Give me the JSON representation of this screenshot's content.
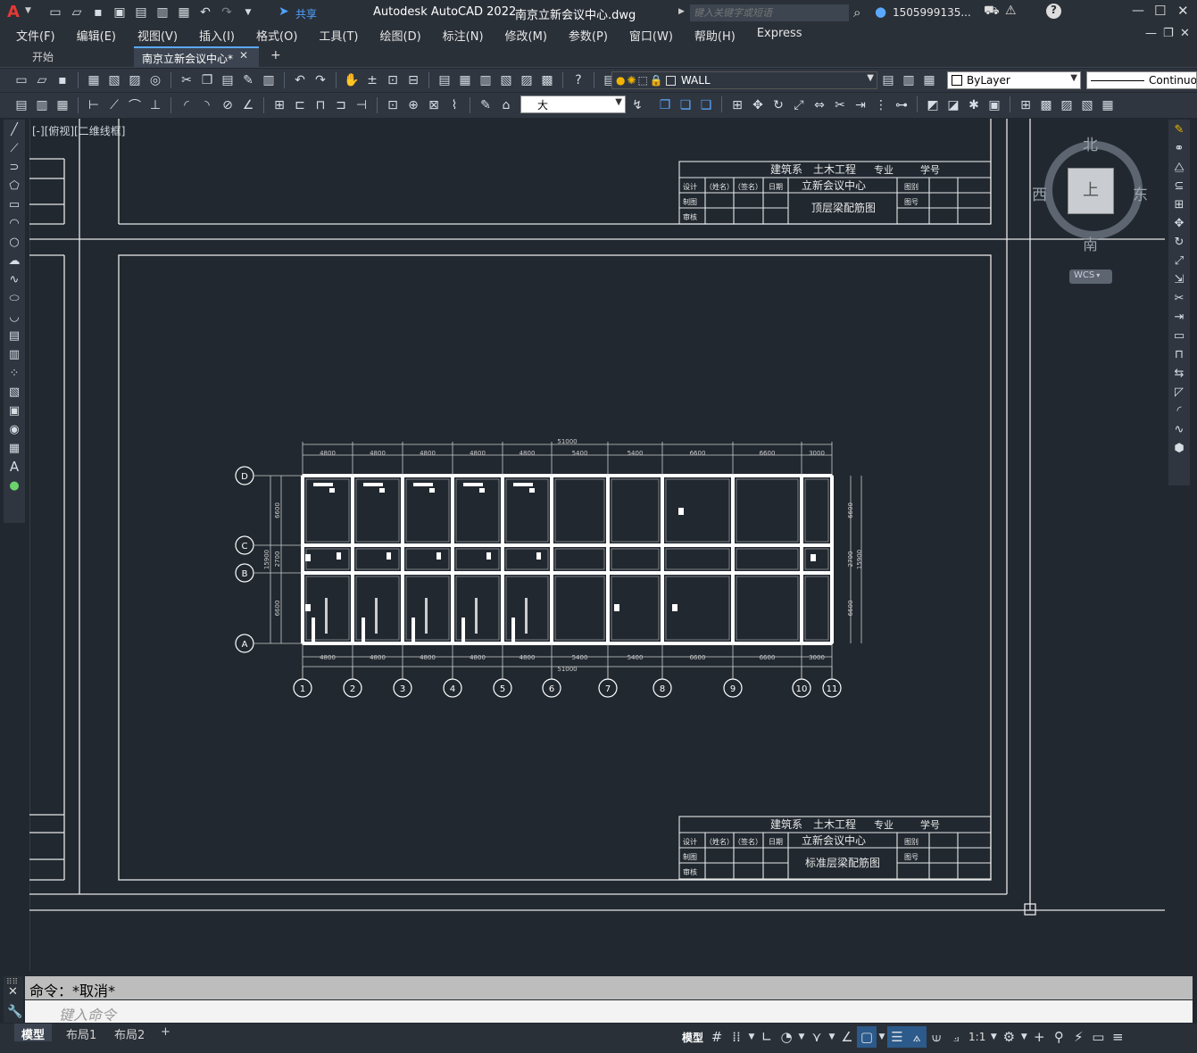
{
  "app": {
    "title": "Autodesk AutoCAD 2022",
    "file": "南京立新会议中心.dwg",
    "logo": "A"
  },
  "title_search": {
    "placeholder": "键入关键字或短语"
  },
  "user": {
    "name": "1505999135..."
  },
  "share_label": "共享",
  "menu": [
    "文件(F)",
    "编辑(E)",
    "视图(V)",
    "插入(I)",
    "格式(O)",
    "工具(T)",
    "绘图(D)",
    "标注(N)",
    "修改(M)",
    "参数(P)",
    "窗口(W)",
    "帮助(H)",
    "Express"
  ],
  "tabs": {
    "start": "开始",
    "current": "南京立新会议中心*",
    "close": "✕",
    "new": "+"
  },
  "layer": {
    "current": "WALL"
  },
  "color": {
    "current": "ByLayer"
  },
  "linetype": {
    "current": "Continuous"
  },
  "textstyle": {
    "current": "大"
  },
  "viewport_label": "[-][俯视][二维线框]",
  "viewcube": {
    "north": "北",
    "south": "南",
    "east": "东",
    "west": "西",
    "face": "上",
    "wcs": "WCS"
  },
  "titleblocks": [
    {
      "dept": "建筑系",
      "major": "土木工程",
      "major_label": "专业",
      "id_label": "学号",
      "project": "立新会议中心",
      "drawing": "顶层梁配筋图",
      "row_design": "设计",
      "row_name": "（姓名）",
      "row_sign": "（签名）",
      "row_date": "日期",
      "row_draw": "制图",
      "row_check": "审核",
      "fig_cat": "图别",
      "fig_no": "图号"
    },
    {
      "dept": "建筑系",
      "major": "土木工程",
      "major_label": "专业",
      "id_label": "学号",
      "project": "立新会议中心",
      "drawing": "标准层梁配筋图",
      "row_design": "设计",
      "row_name": "（姓名）",
      "row_sign": "（签名）",
      "row_date": "日期",
      "row_draw": "制图",
      "row_check": "审核",
      "fig_cat": "图别",
      "fig_no": "图号"
    }
  ],
  "plan": {
    "total": "51000",
    "spans": [
      "4800",
      "4800",
      "4800",
      "4800",
      "4800",
      "5400",
      "5400",
      "6600",
      "6600",
      "3000"
    ],
    "col_axes": [
      "1",
      "2",
      "3",
      "4",
      "5",
      "6",
      "7",
      "8",
      "9",
      "10",
      "11"
    ],
    "row_axes": [
      "D",
      "C",
      "B",
      "A"
    ],
    "side_dims": [
      "6600",
      "2700",
      "6600"
    ],
    "side_total": "15900"
  },
  "command": {
    "history": "命令：*取消*",
    "placeholder": "键入命令"
  },
  "layout_tabs": [
    "模型",
    "布局1",
    "布局2"
  ],
  "status": {
    "model": "模型",
    "scale": "1:1"
  },
  "colors": {
    "bg": "#212830",
    "toolbar": "#2f3640",
    "accent": "#f0b400",
    "brand_red": "#d32f2f"
  }
}
